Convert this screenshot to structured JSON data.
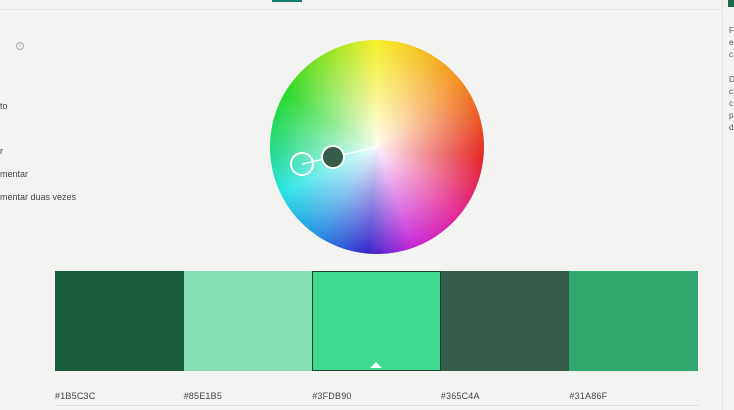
{
  "left_panel": {
    "items": [
      {
        "label": "to"
      },
      {
        "label": "r"
      },
      {
        "label": "mentar"
      },
      {
        "label": "mentar duas vezes"
      }
    ],
    "info_icon_glyph": "i"
  },
  "right_panel": {
    "lines": [
      "F",
      "e",
      "c",
      "",
      "",
      "D",
      "c",
      "c",
      "p",
      "d"
    ]
  },
  "palette": {
    "swatches": [
      {
        "color": "#1B5C3C",
        "hex": "#1B5C3C"
      },
      {
        "color": "#85E1B5",
        "hex": "#85E1B5"
      },
      {
        "color": "#3FDB90",
        "hex": "#3FDB90",
        "selected": true
      },
      {
        "color": "#365C4A",
        "hex": "#365C4A"
      },
      {
        "color": "#31A86F",
        "hex": "#31A86F"
      }
    ],
    "display_hex": [
      "#1B5C3C",
      "#85E1B5",
      "#3FDB90",
      "#365C4A",
      "#31A86F"
    ]
  },
  "wheel": {
    "handle_primary_color": "#365C4A",
    "handle_secondary_color": "#3FDB90"
  },
  "icons": {
    "info": "info-icon",
    "selected_indicator": "caret-up-icon"
  }
}
